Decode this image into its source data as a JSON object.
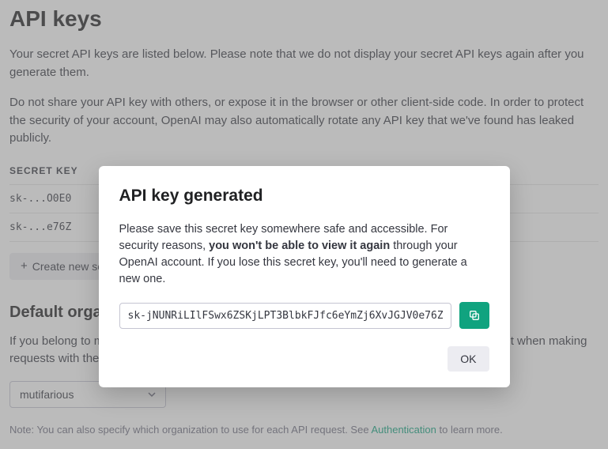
{
  "page": {
    "title": "API keys",
    "intro1": "Your secret API keys are listed below. Please note that we do not display your secret API keys again after you generate them.",
    "intro2": "Do not share your API key with others, or expose it in the browser or other client-side code. In order to protect the security of your account, OpenAI may also automatically rotate any API key that we've found has leaked publicly.",
    "columnHeader": "SECRET KEY",
    "keys": [
      "sk-...O0E0",
      "sk-...e76Z"
    ],
    "createLabel": "Create new secret key",
    "defaultOrgTitle": "Default organization",
    "orgPara": "If you belong to multiple organizations, this setting controls which organization is used by default when making requests with the API keys above.",
    "orgSelected": "mutifarious",
    "notePrefix": "Note: You can also specify which organization to use for each API request. See ",
    "noteLink": "Authentication",
    "noteSuffix": " to learn more."
  },
  "modal": {
    "title": "API key generated",
    "bodyPre": "Please save this secret key somewhere safe and accessible. For security reasons, ",
    "bodyBold": "you won't be able to view it again",
    "bodyPost": " through your OpenAI account. If you lose this secret key, you'll need to generate a new one.",
    "keyValue": "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",
    "okLabel": "OK"
  }
}
